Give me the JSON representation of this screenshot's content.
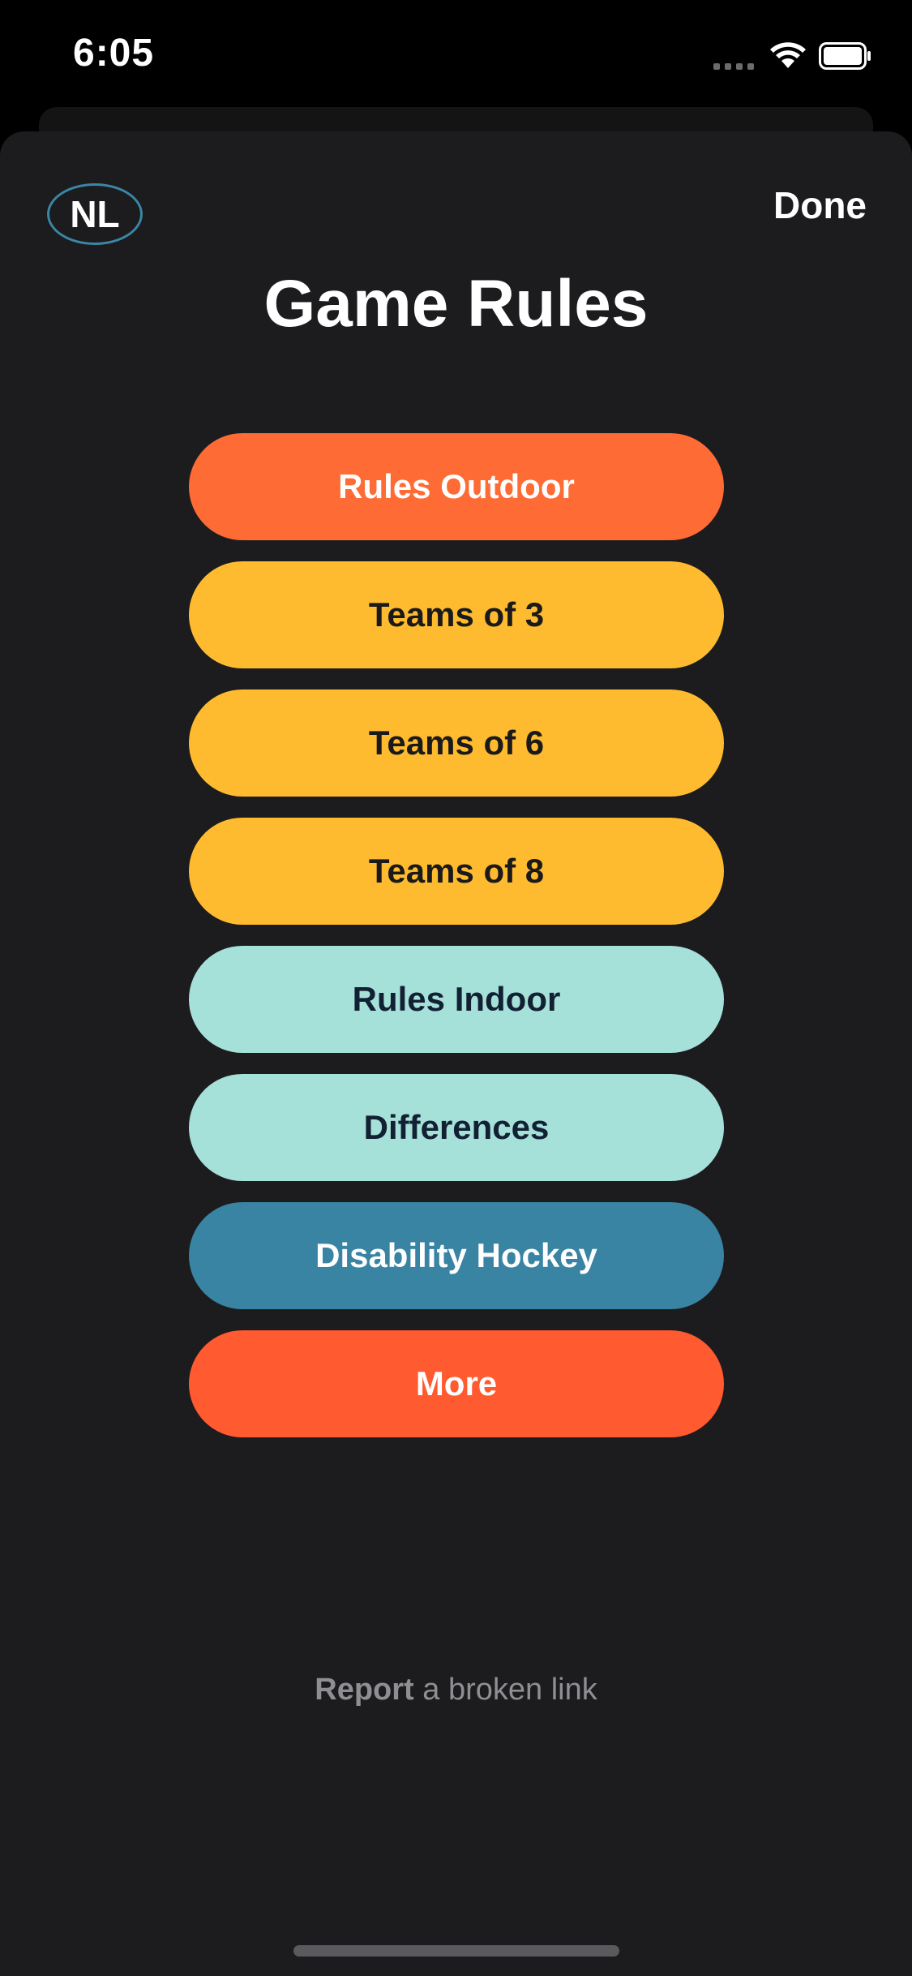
{
  "status_bar": {
    "time": "6:05"
  },
  "header": {
    "language_badge": "NL",
    "done_label": "Done",
    "title": "Game Rules"
  },
  "menu": {
    "items": [
      {
        "label": "Rules Outdoor",
        "color": "#ff6b35"
      },
      {
        "label": "Teams of 3",
        "color": "#ffbb2f"
      },
      {
        "label": "Teams of 6",
        "color": "#ffbb2f"
      },
      {
        "label": "Teams of 8",
        "color": "#ffbb2f"
      },
      {
        "label": "Rules Indoor",
        "color": "#a6e1d9"
      },
      {
        "label": "Differences",
        "color": "#a6e1d9"
      },
      {
        "label": "Disability Hockey",
        "color": "#3983a3"
      },
      {
        "label": "More",
        "color": "#ff5a30"
      }
    ]
  },
  "footer": {
    "report_strong": "Report",
    "report_rest": " a broken link"
  }
}
